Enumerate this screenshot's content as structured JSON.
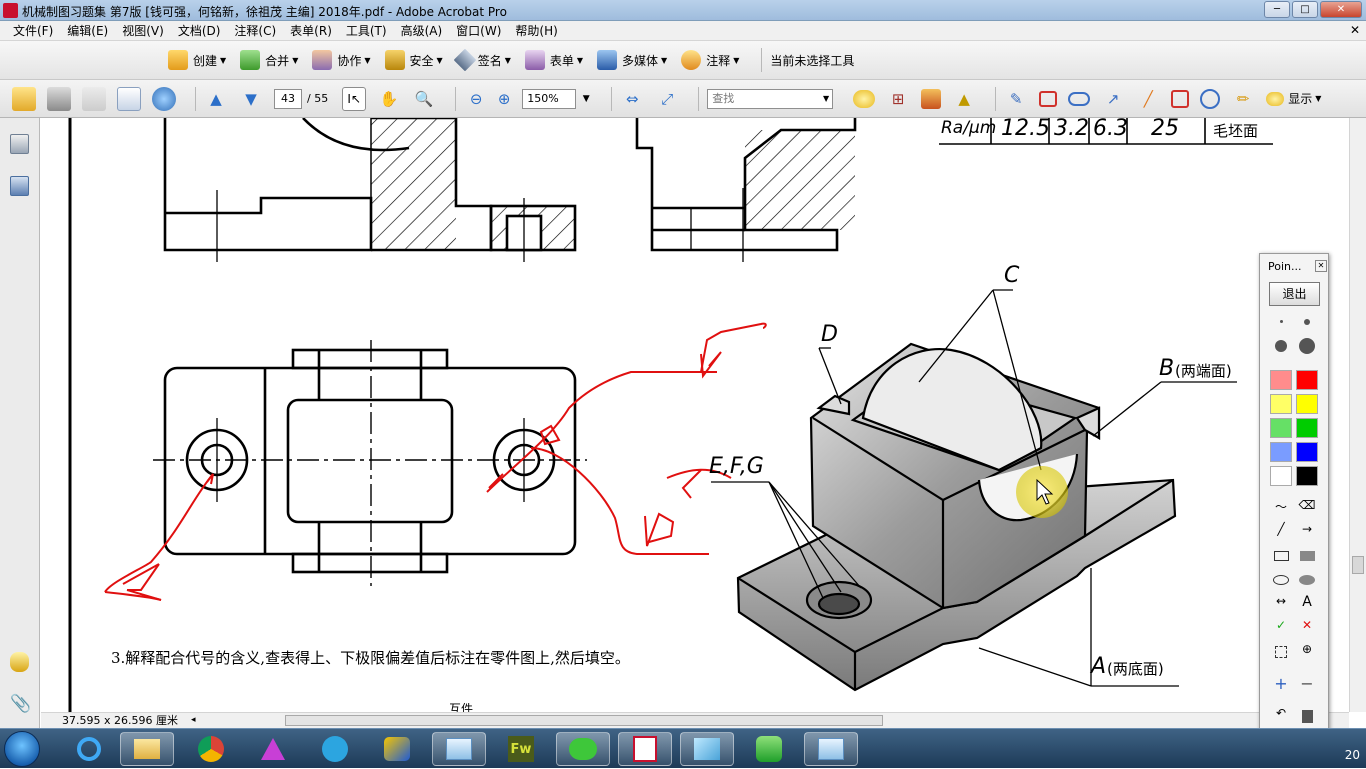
{
  "window": {
    "title": "机械制图习题集 第7版 [钱可强，何铭新，徐祖茂 主编] 2018年.pdf - Adobe Acrobat Pro",
    "minimize": "─",
    "maximize": "□",
    "close": "✕"
  },
  "menu": {
    "items": [
      "文件(F)",
      "编辑(E)",
      "视图(V)",
      "文档(D)",
      "注释(C)",
      "表单(R)",
      "工具(T)",
      "高级(A)",
      "窗口(W)",
      "帮助(H)"
    ],
    "close": "✕"
  },
  "task_toolbar": {
    "items": [
      {
        "label": "创建",
        "icon": "create-icon"
      },
      {
        "label": "合并",
        "icon": "combine-icon"
      },
      {
        "label": "协作",
        "icon": "collaborate-icon"
      },
      {
        "label": "安全",
        "icon": "lock-icon"
      },
      {
        "label": "签名",
        "icon": "pen-icon"
      },
      {
        "label": "表单",
        "icon": "form-icon"
      },
      {
        "label": "多媒体",
        "icon": "multimedia-icon"
      },
      {
        "label": "注释",
        "icon": "comment-icon"
      }
    ],
    "status": "当前未选择工具"
  },
  "nav_toolbar": {
    "page_current": "43",
    "page_total": "/ 55",
    "zoom": "150%",
    "find_placeholder": "查找",
    "display_label": "显示"
  },
  "document": {
    "roughness_table": {
      "label": "Ra/μm",
      "values": [
        "12.5",
        "3.2",
        "6.3",
        "25",
        "毛坯面"
      ]
    },
    "labels": {
      "c": "C",
      "d": "D",
      "b": "B",
      "b_note": "(两端面)",
      "efg": "E,F,G",
      "a": "A",
      "a_note": "(两底面)"
    },
    "question": "3.解释配合代号的含义,查表得上、下极限偏差值后标注在零件图上,然后填空。",
    "bottom_partial": "互件"
  },
  "status_bar": {
    "dimensions": "37.595 x 26.596 厘米"
  },
  "point_panel": {
    "title": "Poin...",
    "exit_label": "退出",
    "colors": [
      "#ff8c8c",
      "#ff0000",
      "#ffff66",
      "#ffff00",
      "#66e066",
      "#00cc00",
      "#7a9cff",
      "#0000ff",
      "#ffffff",
      "#000000"
    ],
    "text_tool": "A"
  },
  "taskbar": {
    "clock": "20",
    "apps": [
      "ie",
      "explorer",
      "chrome",
      "pen-tool",
      "telegram",
      "media",
      "snipping",
      "fireworks",
      "wechat",
      "acrobat",
      "notes",
      "player",
      "recorder"
    ]
  }
}
